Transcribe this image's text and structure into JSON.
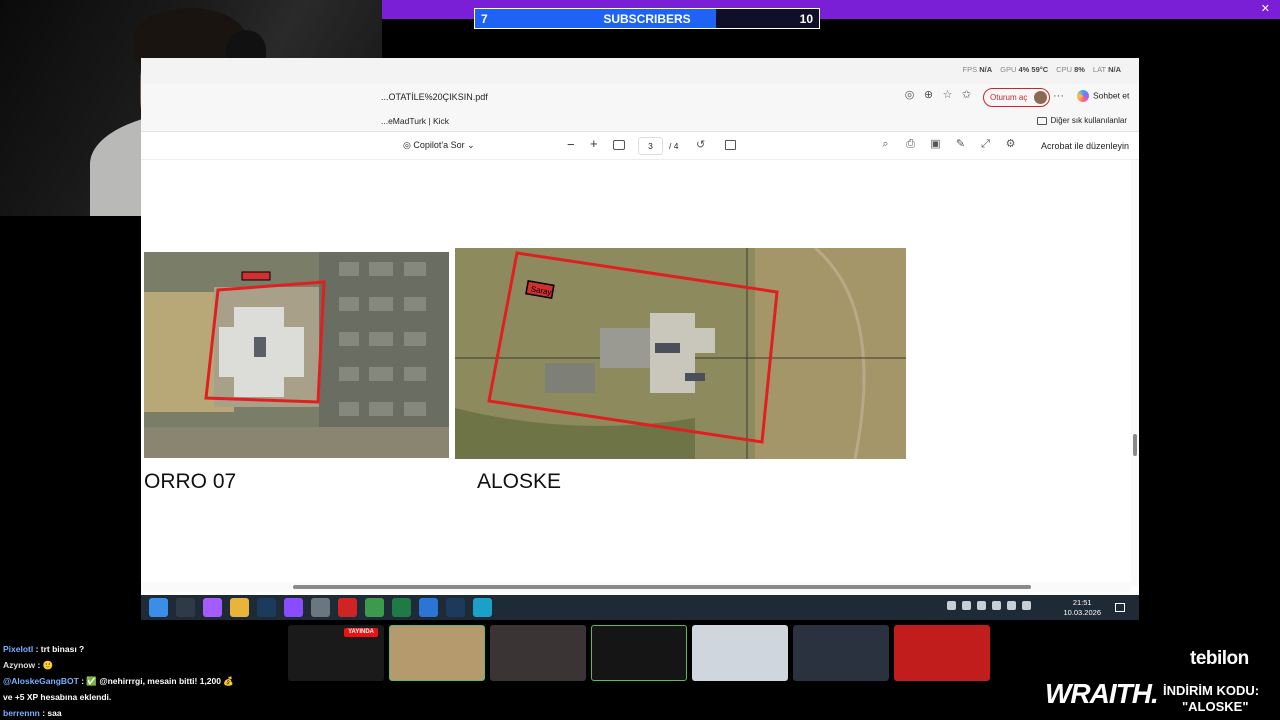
{
  "stream": {
    "subscriber_goal": {
      "current": "7",
      "label": "SUBSCRIBERS",
      "target": "10",
      "progress": 0.7
    },
    "close_glyph": "✕"
  },
  "browser": {
    "stats": [
      {
        "k": "FPS",
        "v": "N/A"
      },
      {
        "k": "GPU",
        "v": "4% 59°C"
      },
      {
        "k": "CPU",
        "v": "8%"
      },
      {
        "k": "LAT",
        "v": "N/A"
      }
    ],
    "address": "...OTATİLE%20ÇIKSIN.pdf",
    "signin_label": "Oturum aç",
    "more_glyph": "···",
    "chat_label": "Sohbet et",
    "bookmark": "...eMadTurk | Kick",
    "other_favorites": "Diğer sık kullanılanlar"
  },
  "pdf_toolbar": {
    "copilot_label": "Copilot'a Sor",
    "page_current": "3",
    "page_total": "/ 4",
    "edit_label": "Acrobat ile düzenleyin"
  },
  "document": {
    "left_caption": "ORRO 07",
    "right_caption": "ALOSKE",
    "right_map_tag": "Saray"
  },
  "taskbar": {
    "time": "21:51",
    "date": "10.03.2026",
    "apps": [
      {
        "name": "windows-start",
        "color": "#3b8ee8"
      },
      {
        "name": "task-view",
        "color": "#2e3a46"
      },
      {
        "name": "copilot",
        "color": "#a55cff"
      },
      {
        "name": "file-explorer",
        "color": "#e8b53a"
      },
      {
        "name": "steam",
        "color": "#1b3a5c"
      },
      {
        "name": "messenger",
        "color": "#8a4cff"
      },
      {
        "name": "app-gray",
        "color": "#6a7680"
      },
      {
        "name": "opera",
        "color": "#d02424"
      },
      {
        "name": "chrome",
        "color": "#3c9a4a"
      },
      {
        "name": "excel",
        "color": "#1f7a45"
      },
      {
        "name": "mail",
        "color": "#2a75d6"
      },
      {
        "name": "steam-2",
        "color": "#1b3a5c"
      },
      {
        "name": "edge",
        "color": "#1ba0c8"
      }
    ]
  },
  "chat": [
    {
      "user": "Pixelotl",
      "msg": ": trt binası ?"
    },
    {
      "user": "Azynow",
      "msg": ": 🙂"
    },
    {
      "user": "@AloskeGangBOT",
      "msg": ": ✅ @nehirrrgi, mesain bitti! 1,200 💰"
    },
    {
      "user": "",
      "msg": "ve +5 XP hesabına eklendi."
    },
    {
      "user": "berrennn",
      "msg": ": saa"
    }
  ],
  "tiles": {
    "live_badge": "YAYINDA"
  },
  "brand": {
    "tebilon": "tebilon",
    "wraith": "WRAITH.",
    "promo_label": "İNDİRİM KODU:",
    "promo_code": "\"ALOSKE\""
  }
}
